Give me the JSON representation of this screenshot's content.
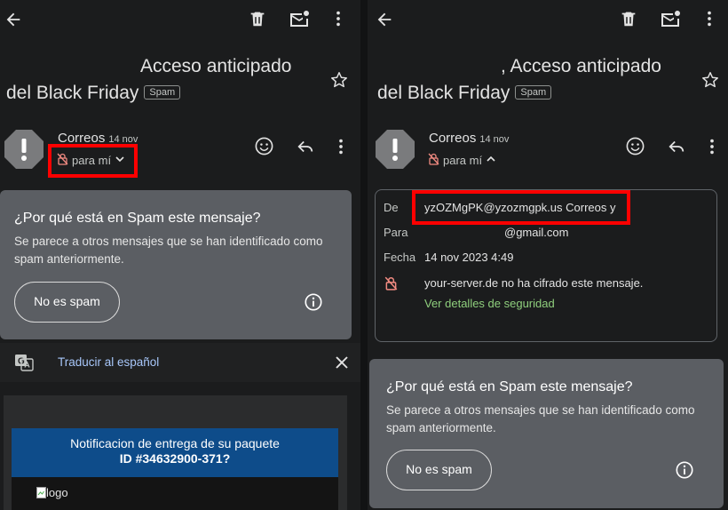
{
  "left_panel": {
    "subject_line1": "Acceso anticipado",
    "subject_line2": "del Black Friday",
    "spam_badge": "Spam",
    "sender_name": "Correos",
    "sender_date": "14 nov",
    "recipient": "para mí",
    "spam_card": {
      "title": "¿Por qué está en Spam este mensaje?",
      "desc_line1": "Se parece a otros mensajes que se han identificado como",
      "desc_line2": "spam anteriormente.",
      "not_spam_button": "No es spam"
    },
    "translate_label": "Traducir al español",
    "email_banner_line1": "Notificacion de entrega de su paquete",
    "email_banner_line2": "ID #34632900-371?",
    "logo_alt": "logo"
  },
  "right_panel": {
    "subject_line1": ", Acceso anticipado",
    "subject_line2": "del Black Friday",
    "spam_badge": "Spam",
    "sender_name": "Correos",
    "sender_date": "14 nov",
    "recipient": "para mí",
    "details": {
      "from_label": "De",
      "from_value": "yzOZMgPK@yzozmgpk.us Correos y",
      "to_label": "Para",
      "to_value": "@gmail.com",
      "date_label": "Fecha",
      "date_value": "14 nov 2023 4:49",
      "encryption_text": "your-server.de no ha cifrado este mensaje.",
      "security_link": "Ver detalles de seguridad"
    },
    "spam_card": {
      "title": "¿Por qué está en Spam este mensaje?",
      "desc_line1": "Se parece a otros mensajes que se han identificado como",
      "desc_line2": "spam anteriormente.",
      "not_spam_button": "No es spam"
    }
  },
  "colors": {
    "background": "#1b1c1d",
    "spam_card": "#5b5e63",
    "highlight": "#ff0000",
    "link_blue": "#a8c7fa",
    "link_green": "#8fcf7d",
    "banner_blue": "#0e4c8a"
  },
  "icons": [
    "back-arrow-icon",
    "trash-icon",
    "mail-unread-icon",
    "more-vert-icon",
    "star-icon",
    "avatar-warning-icon",
    "emoji-icon",
    "reply-icon",
    "no-encryption-icon",
    "chevron-down-icon",
    "chevron-up-icon",
    "info-icon",
    "translate-icon",
    "close-icon"
  ]
}
